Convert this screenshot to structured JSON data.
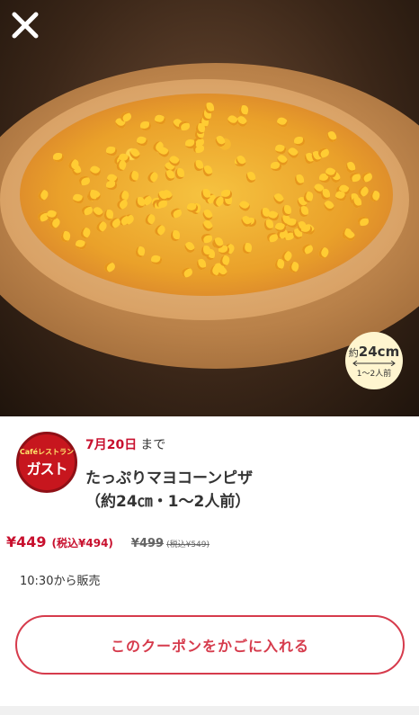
{
  "icons": {
    "close": "close-icon",
    "double_arrow": "double-arrow-icon"
  },
  "colors": {
    "accent_red": "#c8102e",
    "button_red": "#d63b4c",
    "badge_bg": "#fff5cf",
    "logo_red": "#c7161e"
  },
  "hero": {
    "size_badge": {
      "approx": "約",
      "size": "24cm",
      "servings": "1〜2人前"
    }
  },
  "brand": {
    "cafe_label": "Caféレストラン",
    "name": "ガスト"
  },
  "coupon": {
    "expiry_date": "7月20日",
    "expiry_suffix": "まで",
    "title_line1": "たっぷりマヨコーンピザ",
    "title_line2": "（約24㎝・1〜2人前）",
    "price_now": "¥449",
    "price_now_tax": "(税込¥494)",
    "price_old": "¥499",
    "price_old_tax": "(税込¥549)",
    "sale_time": "10:30から販売"
  },
  "actions": {
    "add_to_cart": "このクーポンをかごに入れる"
  }
}
